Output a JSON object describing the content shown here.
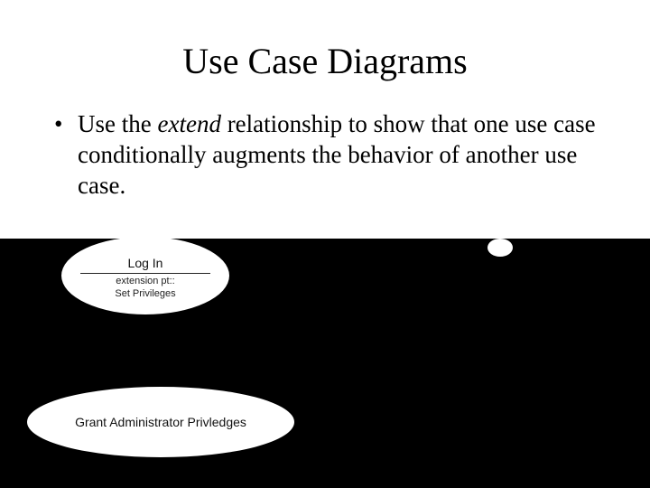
{
  "slide": {
    "title": "Use Case Diagrams",
    "bullet": {
      "marker": "•",
      "text_before_em": "Use the ",
      "em": "extend",
      "text_after_em": " relationship to show that one use case conditionally augments the behavior of another use case."
    }
  },
  "diagram": {
    "use_case_login": {
      "title": "Log In",
      "extension_label_line1": "extension pt::",
      "extension_label_line2": "Set Privileges"
    },
    "use_case_grant": {
      "label": "Grant Administrator Privledges"
    }
  }
}
